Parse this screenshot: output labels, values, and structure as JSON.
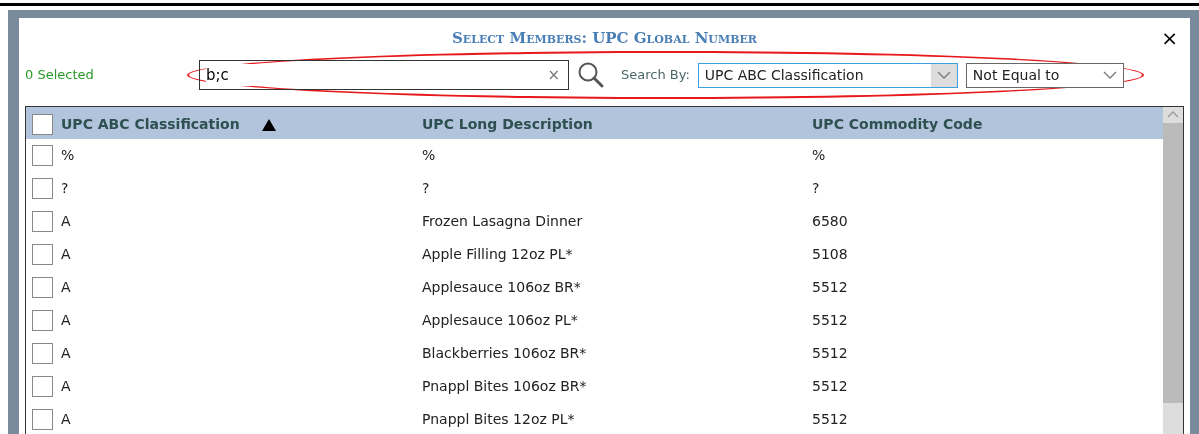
{
  "dialog": {
    "title": "Select Members: UPC Global Number",
    "close": "×"
  },
  "toolbar": {
    "selected_count": "0 Selected",
    "search": {
      "value": "b;c",
      "clear": "×"
    },
    "search_by_label": "Search By:",
    "search_by": {
      "value": "UPC ABC Classification",
      "focused": true
    },
    "operator": {
      "value": "Not Equal to"
    }
  },
  "table": {
    "select_all": {
      "checked": false
    },
    "columns": [
      {
        "label": "UPC ABC Classification",
        "sorted": true
      },
      {
        "label": "UPC Long Description",
        "sorted": false
      },
      {
        "label": "UPC Commodity Code",
        "sorted": false
      }
    ],
    "rows": [
      {
        "checked": false,
        "cells": [
          "%",
          "%",
          "%"
        ]
      },
      {
        "checked": false,
        "cells": [
          "?",
          "?",
          "?"
        ]
      },
      {
        "checked": false,
        "cells": [
          "A",
          "Frozen Lasagna Dinner",
          "6580"
        ]
      },
      {
        "checked": false,
        "cells": [
          "A",
          "Apple Filling 12oz PL*",
          "5108"
        ]
      },
      {
        "checked": false,
        "cells": [
          "A",
          "Applesauce 106oz BR*",
          "5512"
        ]
      },
      {
        "checked": false,
        "cells": [
          "A",
          "Applesauce 106oz PL*",
          "5512"
        ]
      },
      {
        "checked": false,
        "cells": [
          "A",
          "Blackberries 106oz BR*",
          "5512"
        ]
      },
      {
        "checked": false,
        "cells": [
          "A",
          "Pnappl Bites 106oz BR*",
          "5512"
        ]
      },
      {
        "checked": false,
        "cells": [
          "A",
          "Pnappl Bites 12oz PL*",
          "5512"
        ]
      }
    ]
  }
}
